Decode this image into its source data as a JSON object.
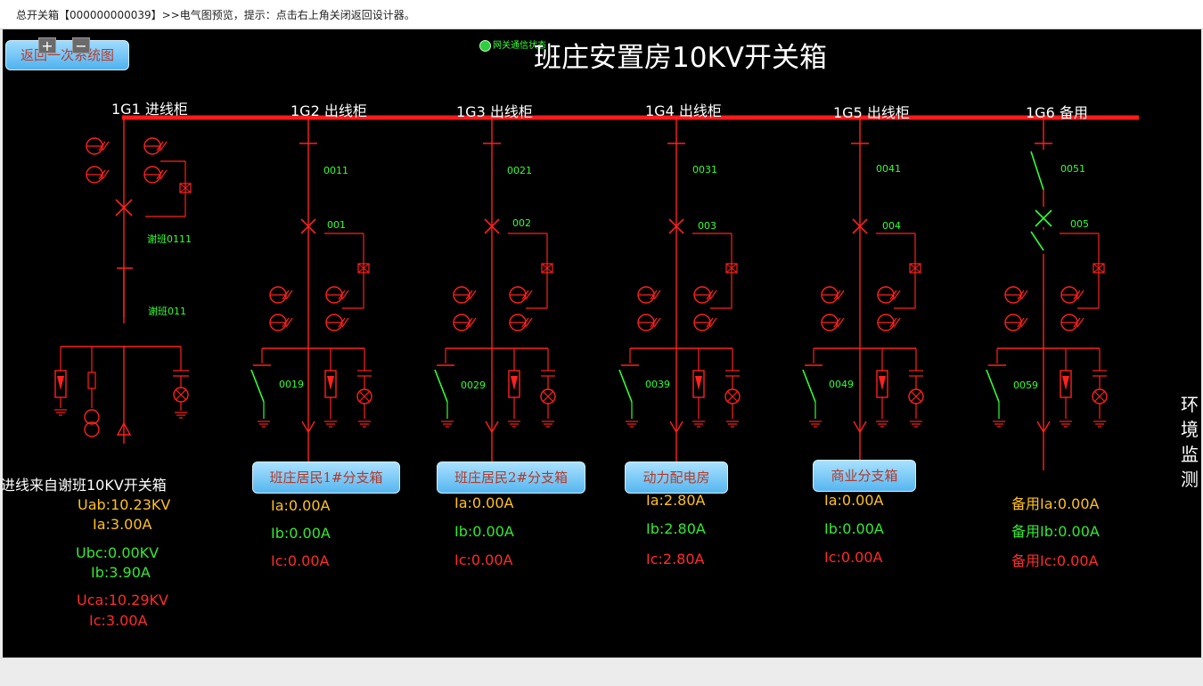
{
  "titlebar": {
    "text": "总开关箱【000000000039】>>电气图预览，提示：点击右上角关闭返回设计器。"
  },
  "toolbar": {
    "zoom_in": "+",
    "zoom_out": "−",
    "back_label": "返回一次系统图"
  },
  "status": {
    "label": "网关通信状态"
  },
  "diagram": {
    "title": "班庄安置房10KV开关箱"
  },
  "colors": {
    "bus": "#ff1a1a",
    "line": "#ff2020",
    "closed_switch": "#33ff33",
    "yellow": "#ffc21a",
    "green": "#35e835",
    "red": "#ff2b2b"
  },
  "cabinets": [
    {
      "name": "1G1 进线柜"
    },
    {
      "name": "1G2 出线柜"
    },
    {
      "name": "1G3 出线柜"
    },
    {
      "name": "1G4 出线柜"
    },
    {
      "name": "1G5 出线柜"
    },
    {
      "name": "1G6 备用"
    }
  ],
  "codes": {
    "g1_breaker": "谢班0111",
    "g1_switch": "谢班011",
    "g2_top": "0011",
    "g2_breaker": "001",
    "g2_earth": "0019",
    "g3_top": "0021",
    "g3_breaker": "002",
    "g3_earth": "0029",
    "g4_top": "0031",
    "g4_breaker": "003",
    "g4_earth": "0039",
    "g5_top": "0041",
    "g5_breaker": "004",
    "g5_earth": "0049",
    "g6_top": "0051",
    "g6_breaker": "005",
    "g6_earth": "0059"
  },
  "incoming": {
    "label": "进线来自谢班10KV开关箱",
    "uab": "Uab:10.23KV",
    "ia": "Ia:3.00A",
    "ubc": "Ubc:0.00KV",
    "ib": "Ib:3.90A",
    "uca": "Uca:10.29KV",
    "ic": "Ic:3.00A"
  },
  "branches": [
    {
      "button": "班庄居民1#分支箱",
      "ia": "Ia:0.00A",
      "ib": "Ib:0.00A",
      "ic": "Ic:0.00A"
    },
    {
      "button": "班庄居民2#分支箱",
      "ia": "Ia:0.00A",
      "ib": "Ib:0.00A",
      "ic": "Ic:0.00A"
    },
    {
      "button": "动力配电房",
      "ia": "Ia:2.80A",
      "ib": "Ib:2.80A",
      "ic": "Ic:2.80A"
    },
    {
      "button": "商业分支箱",
      "ia": "Ia:0.00A",
      "ib": "Ib:0.00A",
      "ic": "Ic:0.00A"
    },
    {
      "button": "",
      "ia": "备用Ia:0.00A",
      "ib": "备用Ib:0.00A",
      "ic": "备用Ic:0.00A"
    }
  ],
  "side": {
    "env_label": "环境监测"
  }
}
